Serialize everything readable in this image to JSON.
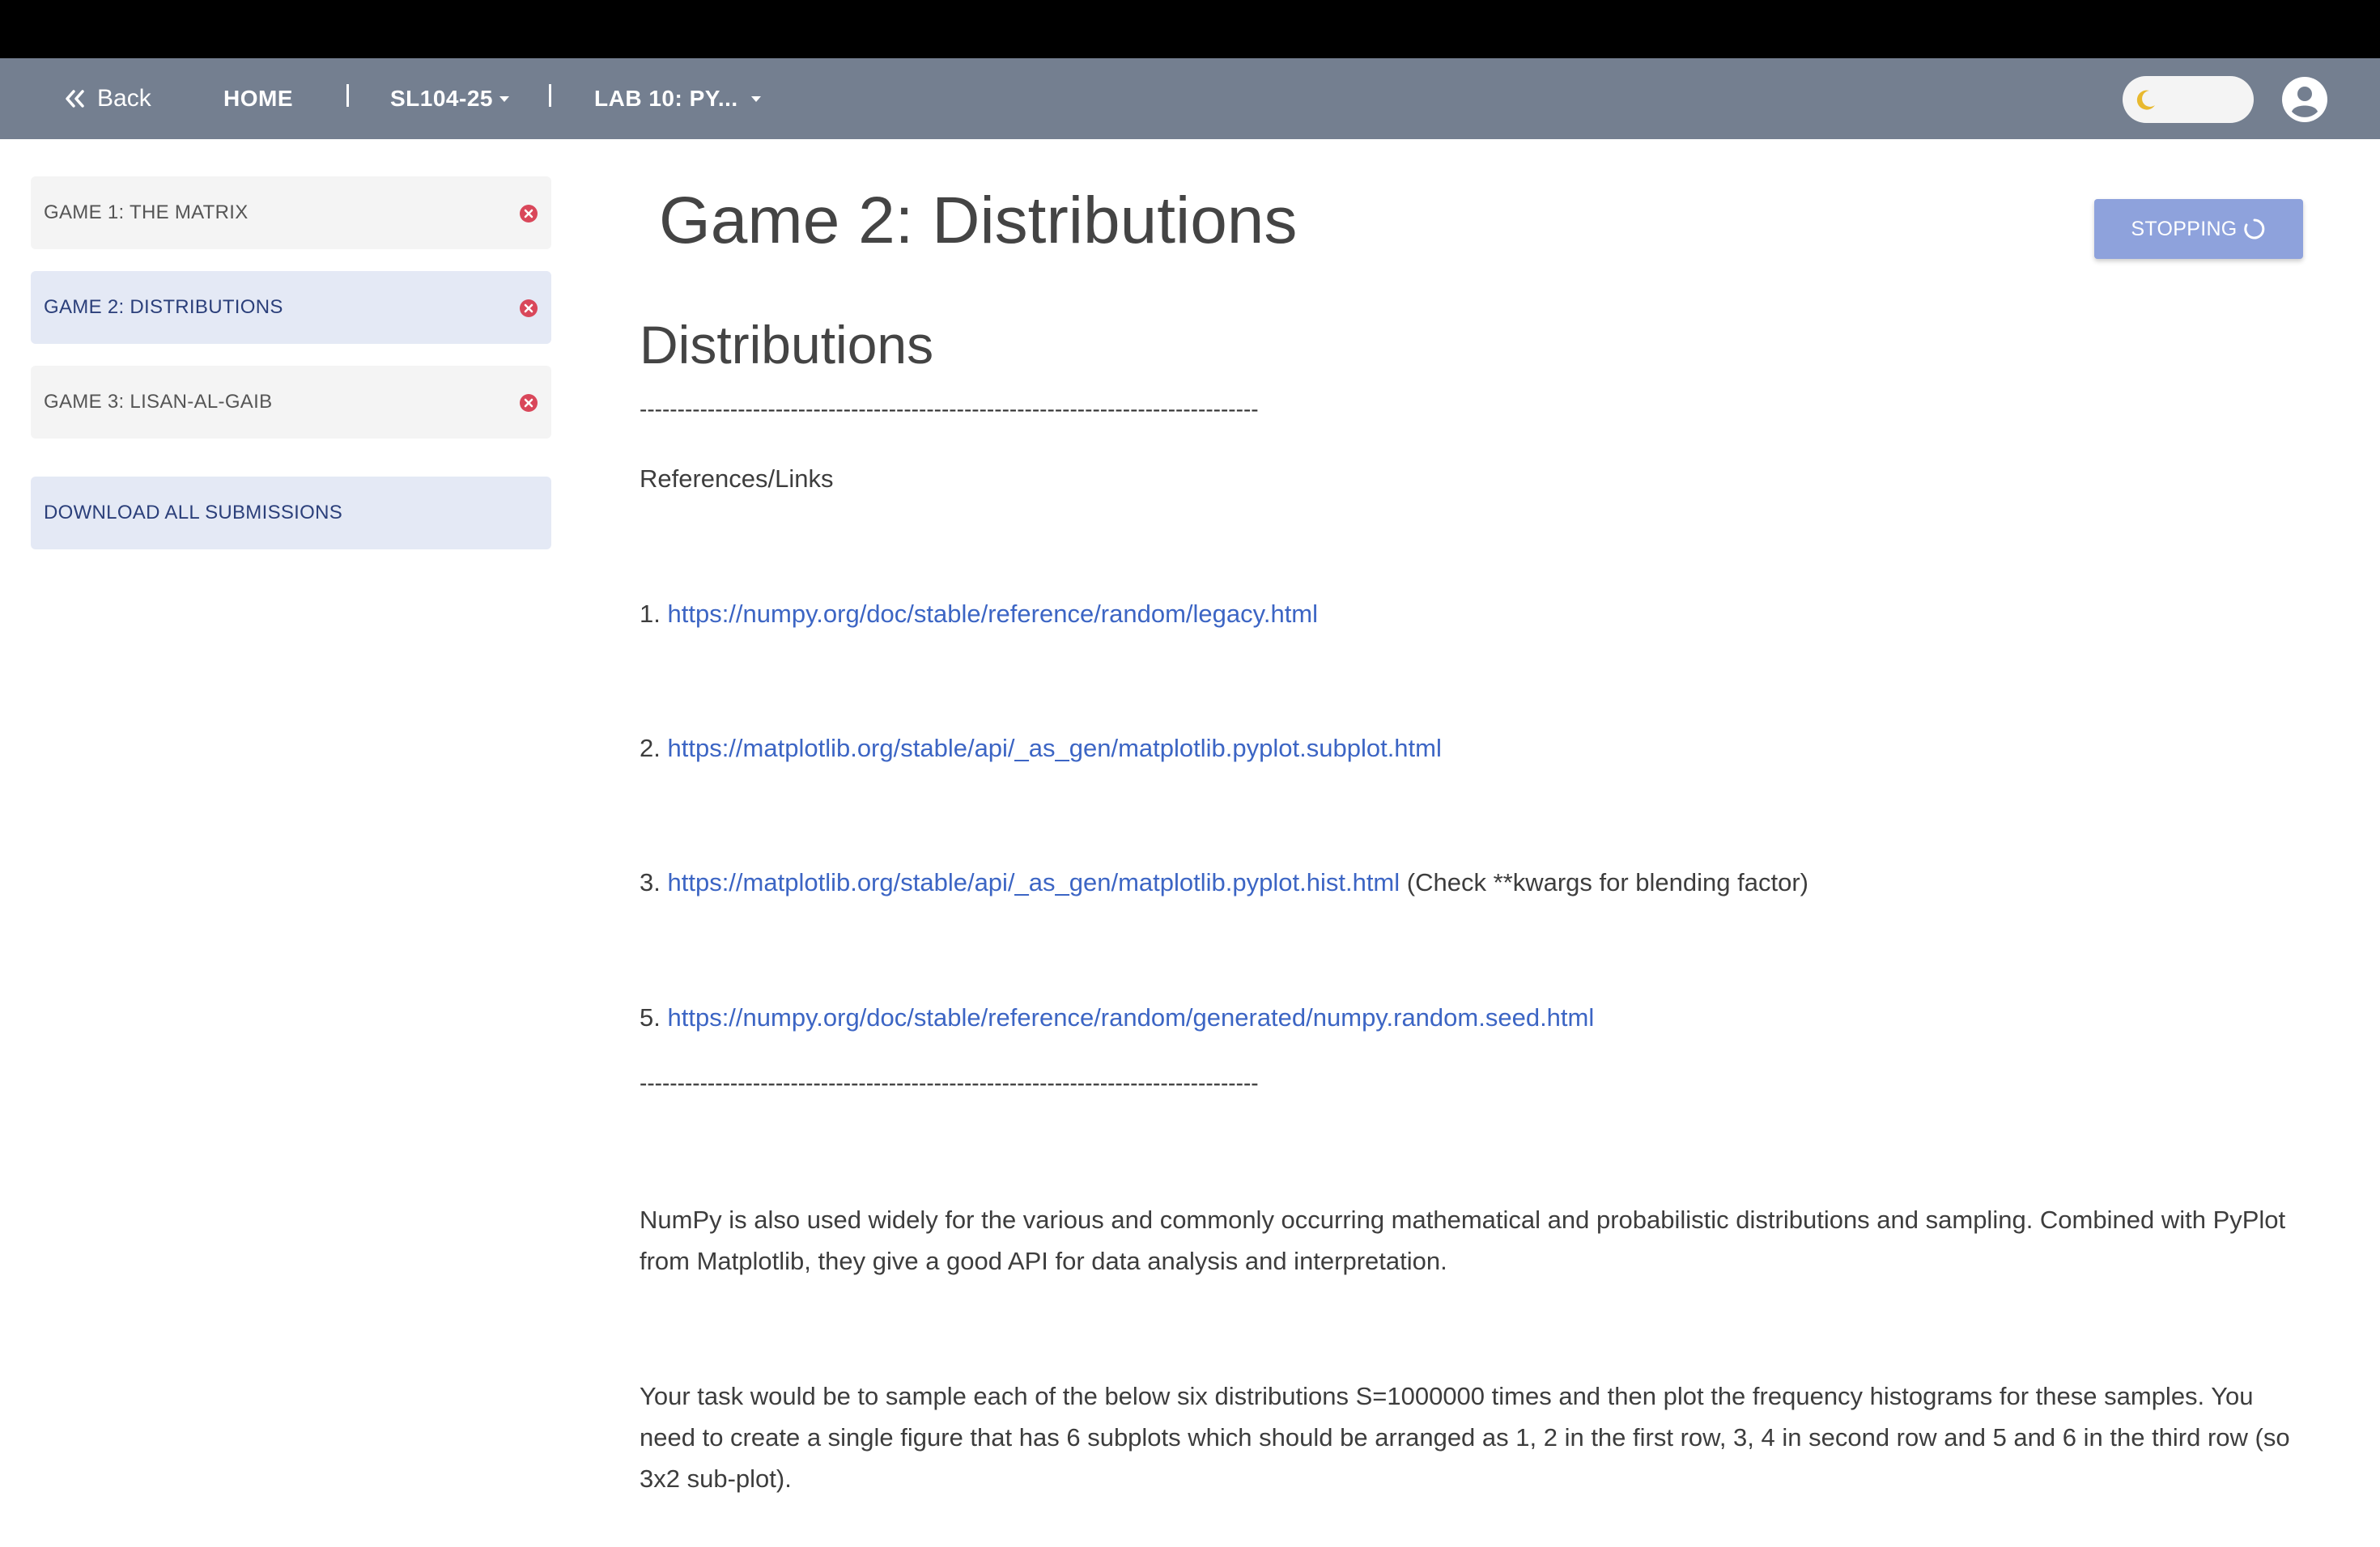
{
  "nav": {
    "back_label": "Back",
    "home_label": "HOME",
    "course_label": "SL104-25",
    "lab_label": "LAB 10: PY..."
  },
  "sidebar": {
    "items": [
      {
        "label": "GAME 1: THE MATRIX",
        "active": false
      },
      {
        "label": "GAME 2: DISTRIBUTIONS",
        "active": true
      },
      {
        "label": "GAME 3: LISAN-AL-GAIB",
        "active": false
      }
    ],
    "download_label": "DOWNLOAD ALL SUBMISSIONS"
  },
  "main": {
    "title": "Game 2: Distributions",
    "stop_button_label": "STOPPING",
    "heading": "Distributions",
    "divider": "----------------------------------------------------------------------------------",
    "references_label": "References/Links",
    "links": [
      {
        "num": "1.",
        "url": "https://numpy.org/doc/stable/reference/random/legacy.html",
        "suffix": ""
      },
      {
        "num": "2.",
        "url": "https://matplotlib.org/stable/api/_as_gen/matplotlib.pyplot.subplot.html",
        "suffix": ""
      },
      {
        "num": "3.",
        "url": "https://matplotlib.org/stable/api/_as_gen/matplotlib.pyplot.hist.html",
        "suffix": "(Check **kwargs for blending factor)"
      },
      {
        "num": "5.",
        "url": "https://numpy.org/doc/stable/reference/random/generated/numpy.random.seed.html",
        "suffix": ""
      }
    ],
    "para1": "NumPy is also used widely for the various and commonly occurring mathematical and probabilistic distributions and sampling. Combined with PyPlot from Matplotlib, they give a good API for data analysis and interpretation.",
    "para2": "Your task would be to sample each of the below six distributions S=1000000 times and then plot the frequency histograms for these samples. You need to create a single figure that has 6 subplots which should be arranged as 1, 2 in the first row, 3, 4 in second row and 5 and 6 in the third row (so 3x2 sub-plot)."
  },
  "colors": {
    "navbar": "#747f90",
    "accent_button": "#8ea2dc",
    "link": "#3c65c4",
    "close_icon": "#d9475a",
    "active_item_bg": "#e4e9f5"
  }
}
